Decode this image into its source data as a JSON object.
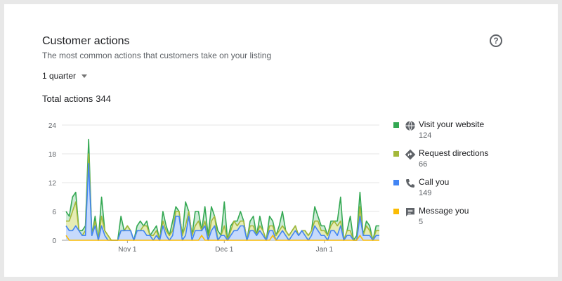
{
  "header": {
    "title": "Customer actions",
    "subtitle": "The most common actions that customers take on your listing",
    "help_icon": "help-circle-icon"
  },
  "period": {
    "label": "1 quarter"
  },
  "total": {
    "label": "Total actions",
    "value": "344"
  },
  "chart_data": {
    "type": "area",
    "stacked": true,
    "ylim": [
      0,
      24
    ],
    "yticks": [
      "0",
      "6",
      "12",
      "18",
      "24"
    ],
    "xtick_labels": [
      "Nov 1",
      "Dec 1",
      "Jan 1"
    ],
    "xtick_days": [
      19,
      49,
      80
    ],
    "grid": true,
    "legend_position": "right",
    "series": [
      {
        "name": "Call you",
        "color": "#4285f4",
        "values": [
          3,
          2,
          2,
          3,
          2,
          1,
          1,
          16,
          1,
          3,
          0,
          3,
          1,
          0,
          0,
          0,
          0,
          2,
          2,
          2,
          2,
          0,
          2,
          2,
          2,
          1,
          1,
          0,
          1,
          0,
          3,
          1,
          0,
          1,
          5,
          5,
          0,
          1,
          5,
          0,
          2,
          2,
          2,
          3,
          0,
          2,
          3,
          0,
          1,
          1,
          0,
          1,
          2,
          2,
          3,
          3,
          0,
          2,
          2,
          1,
          2,
          1,
          0,
          2,
          2,
          0,
          1,
          2,
          1,
          0,
          1,
          2,
          1,
          2,
          1,
          0,
          1,
          3,
          2,
          1,
          1,
          0,
          2,
          2,
          1,
          3,
          0,
          1,
          1,
          0,
          0,
          5,
          1,
          1,
          1,
          0,
          1,
          1
        ]
      },
      {
        "name": "Request directions",
        "color": "#a4b83a",
        "values": [
          1,
          2,
          4,
          5,
          0,
          0,
          1,
          2,
          0,
          1,
          0,
          2,
          1,
          1,
          0,
          0,
          0,
          0,
          0,
          1,
          0,
          0,
          0,
          0,
          1,
          2,
          0,
          1,
          1,
          0,
          1,
          1,
          1,
          1,
          1,
          1,
          1,
          2,
          1,
          1,
          1,
          2,
          0,
          1,
          0,
          2,
          2,
          0,
          0,
          2,
          0,
          1,
          2,
          1,
          1,
          1,
          0,
          1,
          1,
          0,
          1,
          1,
          0,
          1,
          1,
          1,
          1,
          1,
          1,
          1,
          1,
          1,
          0,
          0,
          1,
          1,
          1,
          1,
          2,
          1,
          1,
          1,
          1,
          2,
          2,
          1,
          0,
          1,
          1,
          0,
          0,
          2,
          0,
          2,
          1,
          0,
          1,
          1
        ]
      },
      {
        "name": "Visit your website",
        "color": "#34a853",
        "values": [
          2,
          1,
          3,
          2,
          0,
          1,
          1,
          3,
          0,
          1,
          0,
          4,
          0,
          0,
          0,
          0,
          0,
          3,
          0,
          0,
          0,
          0,
          1,
          2,
          0,
          1,
          0,
          1,
          1,
          0,
          2,
          1,
          0,
          2,
          1,
          0,
          0,
          5,
          0,
          0,
          3,
          2,
          0,
          3,
          1,
          3,
          0,
          2,
          0,
          5,
          0,
          1,
          0,
          1,
          2,
          0,
          0,
          1,
          2,
          0,
          2,
          0,
          0,
          2,
          1,
          0,
          1,
          3,
          0,
          0,
          0,
          0,
          0,
          0,
          0,
          0,
          0,
          3,
          1,
          1,
          1,
          0,
          1,
          0,
          1,
          5,
          0,
          0,
          3,
          0,
          1,
          3,
          0,
          1,
          1,
          0,
          1,
          1
        ]
      },
      {
        "name": "Message you",
        "color": "#fbbc04",
        "values": [
          1,
          0,
          0,
          0,
          0,
          0,
          0,
          0,
          0,
          0,
          0,
          0,
          0,
          0,
          0,
          0,
          0,
          0,
          0,
          0,
          0,
          0,
          0,
          0,
          0,
          0,
          0,
          0,
          0,
          0,
          0,
          0,
          0,
          0,
          0,
          0,
          0,
          0,
          0,
          0,
          0,
          0,
          1,
          0,
          0,
          0,
          0,
          0,
          0,
          0,
          0,
          0,
          0,
          0,
          0,
          0,
          0,
          0,
          0,
          0,
          0,
          0,
          0,
          0,
          1,
          0,
          0,
          0,
          0,
          0,
          0,
          0,
          0,
          0,
          0,
          0,
          0,
          0,
          0,
          0,
          0,
          0,
          0,
          0,
          0,
          0,
          0,
          0,
          0,
          0,
          0,
          1,
          0,
          0,
          0,
          0,
          0,
          0
        ]
      }
    ]
  },
  "legend": [
    {
      "label": "Visit your website",
      "count": "124",
      "color": "#34a853",
      "icon": "globe-icon"
    },
    {
      "label": "Request directions",
      "count": "66",
      "color": "#a4b83a",
      "icon": "directions-icon"
    },
    {
      "label": "Call you",
      "count": "149",
      "color": "#4285f4",
      "icon": "phone-icon"
    },
    {
      "label": "Message you",
      "count": "5",
      "color": "#fbbc04",
      "icon": "message-icon"
    }
  ]
}
